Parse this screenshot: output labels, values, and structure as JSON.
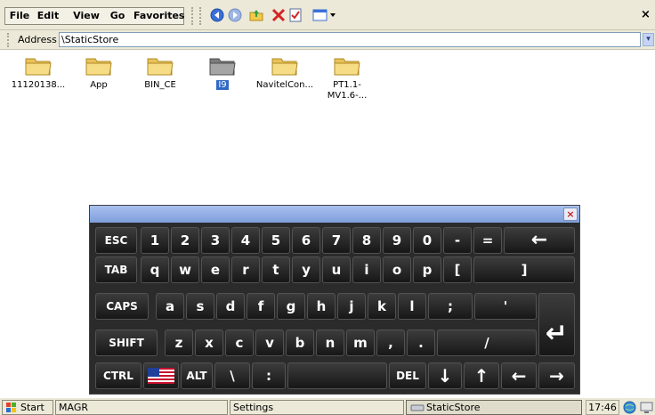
{
  "menubar": {
    "menus": [
      "File",
      "Edit",
      "View",
      "Go",
      "Favorites"
    ],
    "toolbar_icons": [
      "back-icon",
      "forward-icon",
      "up-folder-icon",
      "delete-icon",
      "properties-icon",
      "views-icon"
    ],
    "close_label": "×"
  },
  "address": {
    "label": "Address",
    "value": "\\StaticStore",
    "dropdown_glyph": "▾"
  },
  "folders": [
    {
      "label": "11120138...",
      "selected": false
    },
    {
      "label": "App",
      "selected": false
    },
    {
      "label": "BIN_CE",
      "selected": false
    },
    {
      "label": "I9",
      "selected": true
    },
    {
      "label": "NavitelCon...",
      "selected": false
    },
    {
      "label": "PT1.1-\nMV1.6-...",
      "selected": false
    }
  ],
  "keyboard": {
    "close_label": "×",
    "rows": [
      [
        "ESC",
        "1",
        "2",
        "3",
        "4",
        "5",
        "6",
        "7",
        "8",
        "9",
        "0",
        "-",
        "=",
        "←"
      ],
      [
        "TAB",
        "q",
        "w",
        "e",
        "r",
        "t",
        "y",
        "u",
        "i",
        "o",
        "p",
        "[",
        "]"
      ],
      [
        "CAPS",
        "a",
        "s",
        "d",
        "f",
        "g",
        "h",
        "j",
        "k",
        "l",
        ";",
        "'",
        "↵"
      ],
      [
        "SHIFT",
        "z",
        "x",
        "c",
        "v",
        "b",
        "n",
        "m",
        ",",
        ".",
        "/"
      ],
      [
        "CTRL",
        "flag",
        "ALT",
        "\\",
        ":",
        " ",
        "DEL",
        "↓",
        "↑",
        "←",
        "→"
      ]
    ]
  },
  "taskbar": {
    "start": "Start",
    "items": [
      "MAGR",
      "Settings",
      "StaticStore"
    ],
    "clock": "17:46"
  },
  "colors": {
    "selection": "#3169c6",
    "keyboard_bg": "#2b2b2b",
    "folder_yellow": "#f5d77a",
    "folder_gray": "#9a9a9a"
  }
}
